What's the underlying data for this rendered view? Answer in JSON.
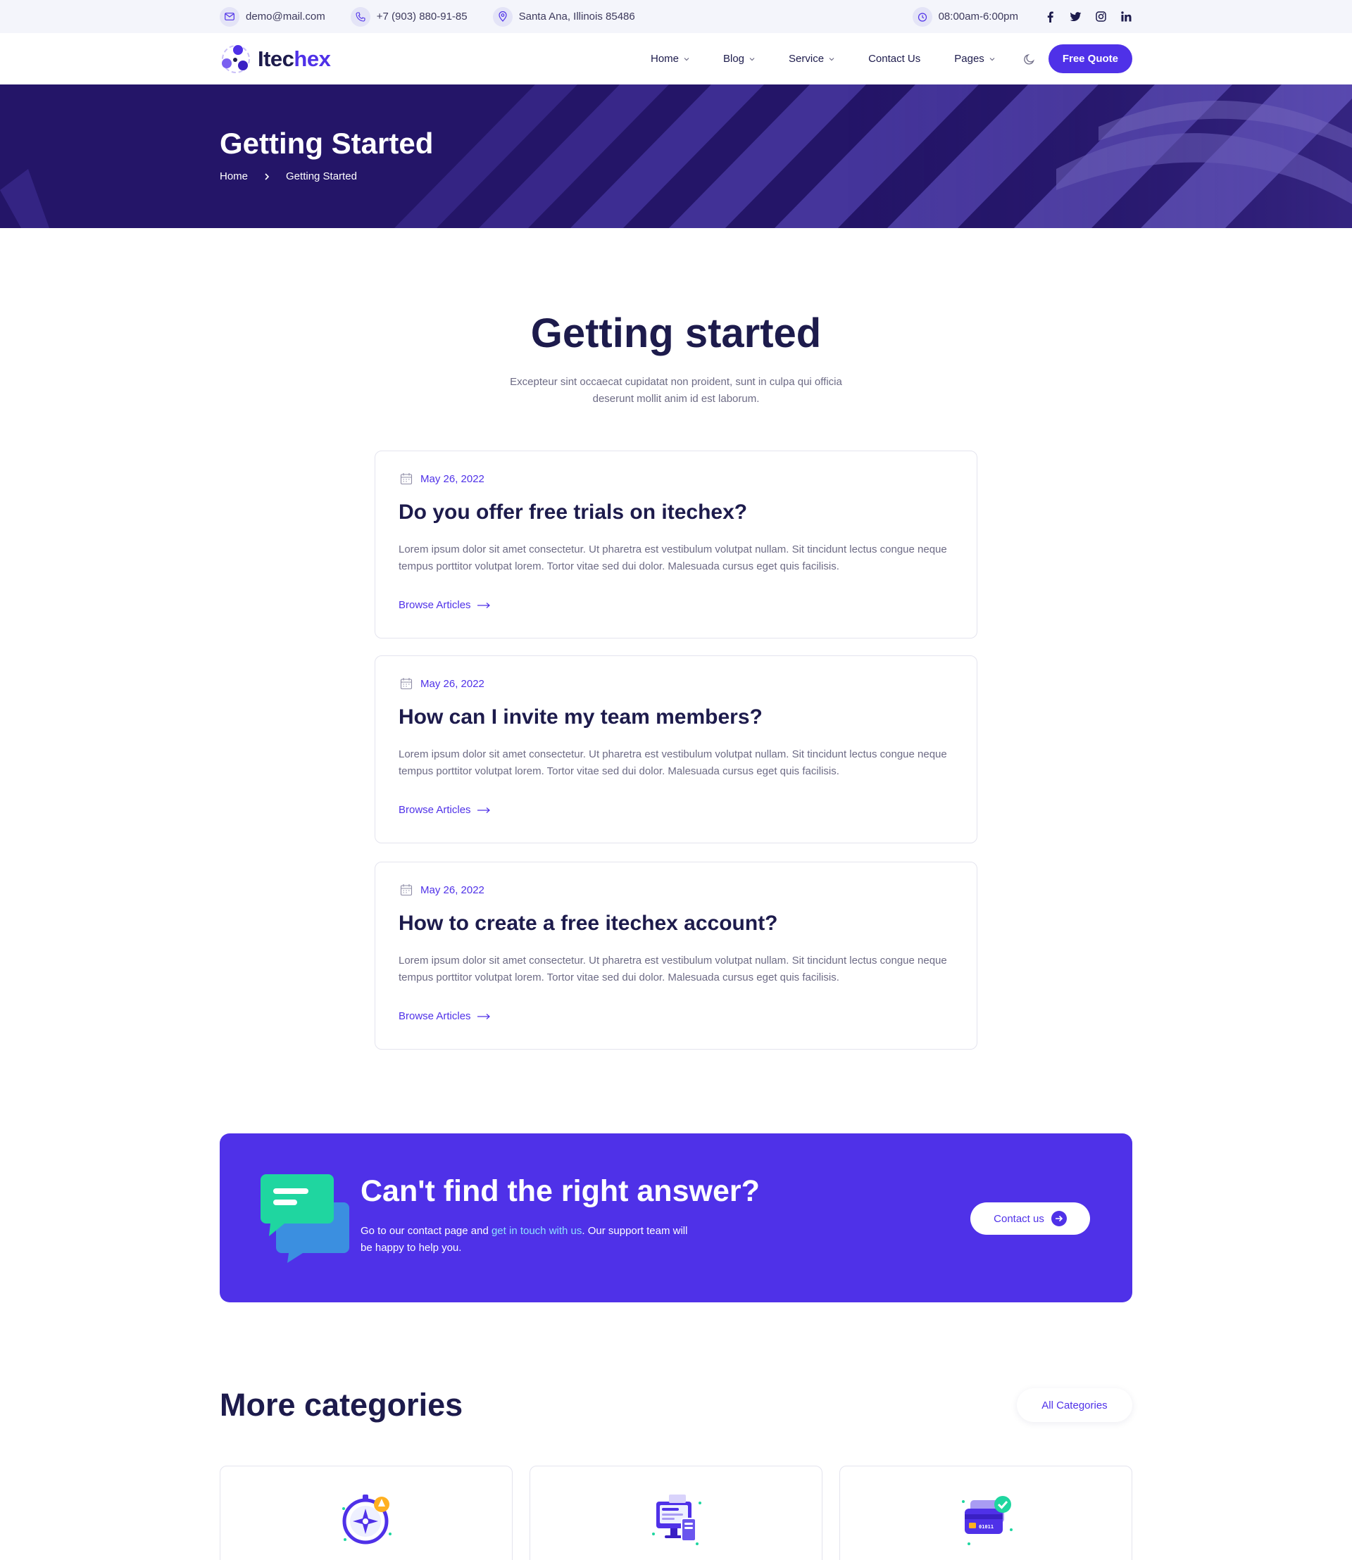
{
  "topbar": {
    "email": "demo@mail.com",
    "phone": "+7 (903) 880-91-85",
    "address": "Santa Ana, Illinois 85486",
    "hours": "08:00am-6:00pm",
    "social": [
      "facebook-icon",
      "twitter-icon",
      "instagram-icon",
      "linkedin-icon"
    ]
  },
  "nav": {
    "logo_part1": "Itec",
    "logo_part2": "hex",
    "items": [
      {
        "label": "Home",
        "dropdown": true
      },
      {
        "label": "Blog",
        "dropdown": true
      },
      {
        "label": "Service",
        "dropdown": true
      },
      {
        "label": "Contact Us",
        "dropdown": false
      },
      {
        "label": "Pages",
        "dropdown": true
      }
    ],
    "cta": "Free Quote"
  },
  "hero": {
    "title": "Getting Started",
    "breadcrumb": [
      "Home",
      "Getting Started"
    ]
  },
  "section": {
    "title": "Getting started",
    "subtitle": "Excepteur sint occaecat cupidatat non proident, sunt in culpa qui officia deserunt mollit anim id est laborum."
  },
  "articles": [
    {
      "date": "May 26, 2022",
      "title": "Do you offer free trials on itechex?",
      "body": "Lorem ipsum dolor sit amet consectetur. Ut pharetra est vestibulum volutpat nullam. Sit tincidunt lectus congue neque tempus porttitor volutpat lorem. Tortor vitae sed dui dolor. Malesuada cursus eget quis facilisis.",
      "link": "Browse Articles"
    },
    {
      "date": "May 26, 2022",
      "title": "How can I invite my team members?",
      "body": "Lorem ipsum dolor sit amet consectetur. Ut pharetra est vestibulum volutpat nullam. Sit tincidunt lectus congue neque tempus porttitor volutpat lorem. Tortor vitae sed dui dolor. Malesuada cursus eget quis facilisis.",
      "link": "Browse Articles"
    },
    {
      "date": "May 26, 2022",
      "title": "How to create a free itechex account?",
      "body": "Lorem ipsum dolor sit amet consectetur. Ut pharetra est vestibulum volutpat nullam. Sit tincidunt lectus congue neque tempus porttitor volutpat lorem. Tortor vitae sed dui dolor. Malesuada cursus eget quis facilisis.",
      "link": "Browse Articles"
    }
  ],
  "cta": {
    "title": "Can't find the right answer?",
    "text_before": "Go to our contact page and ",
    "text_link": "get in touch with us",
    "text_after": ". Our support team will be happy to help you.",
    "button": "Contact us"
  },
  "more": {
    "title": "More categories",
    "button": "All Categories",
    "categories": [
      {
        "icon": "compass-icon"
      },
      {
        "icon": "computer-devices-icon"
      },
      {
        "icon": "credit-card-icon"
      }
    ]
  },
  "colors": {
    "brand": "#4f31e8",
    "dark": "#1d1b4c",
    "hero_bg": "#241568",
    "muted": "#6d6b85"
  }
}
